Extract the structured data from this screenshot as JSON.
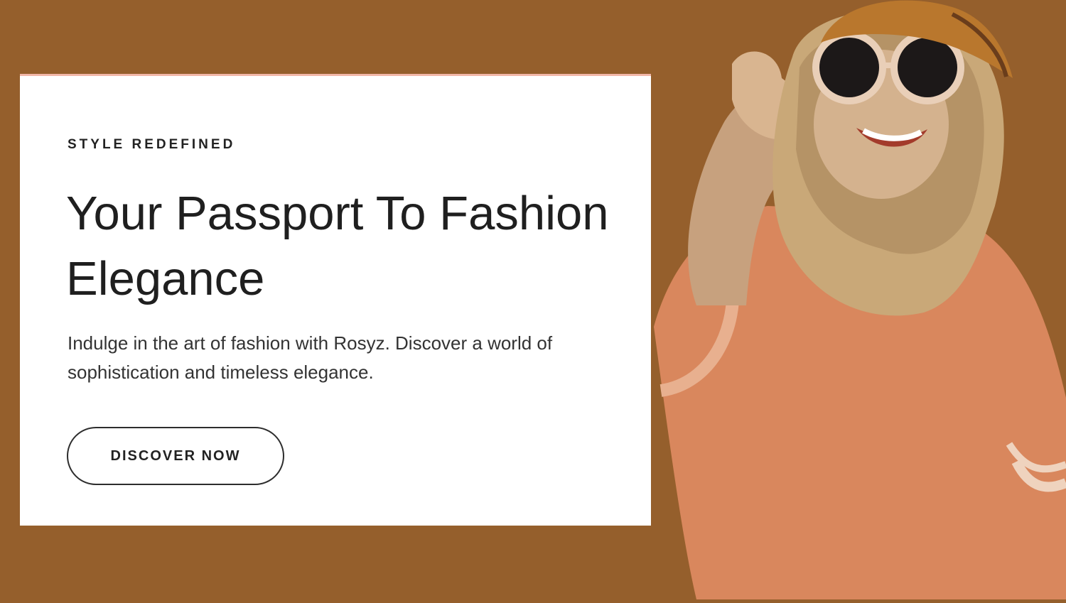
{
  "hero": {
    "eyebrow": "STYLE REDEFINED",
    "headline_line1": "Your Passport To Fashion",
    "headline_line2": "Elegance",
    "description_line1": "Indulge in the art of fashion with Rosyz. Discover a world of",
    "description_line2": "sophistication and timeless elegance.",
    "cta_label": "DISCOVER NOW"
  },
  "colors": {
    "background": "#955f2c",
    "card": "#ffffff",
    "card_top_border": "#f2b7a8",
    "text_dark": "#1f1f1f"
  },
  "image": {
    "subject": "model-photo"
  }
}
